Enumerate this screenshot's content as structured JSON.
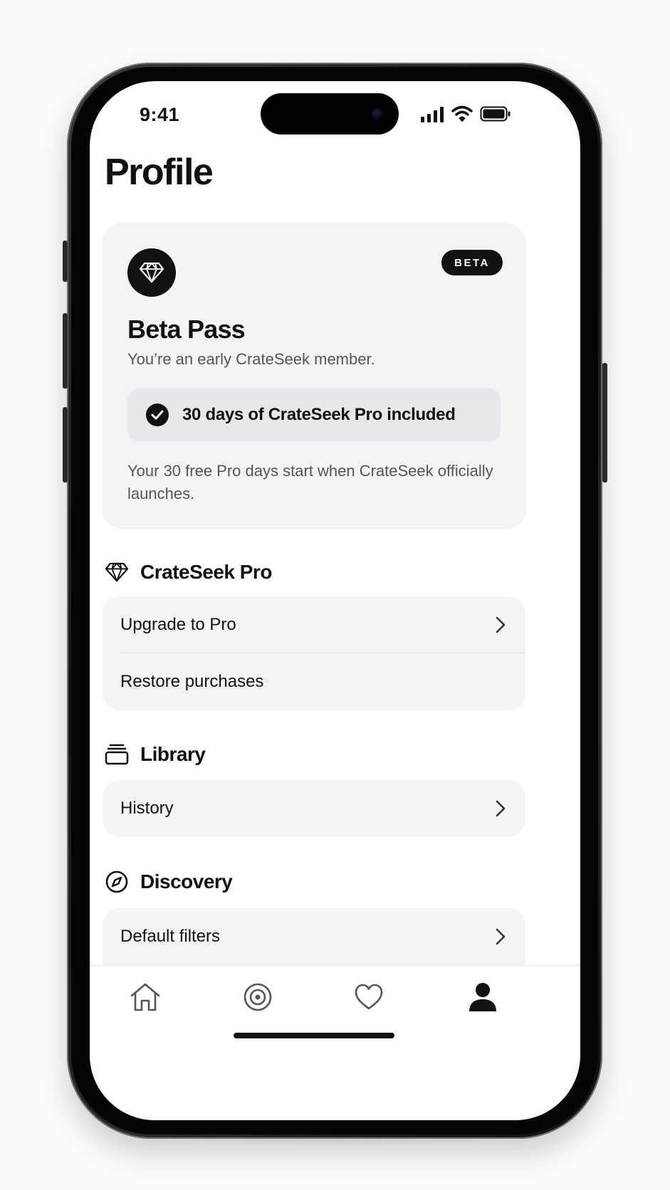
{
  "status_bar": {
    "time": "9:41"
  },
  "page": {
    "title": "Profile"
  },
  "beta_card": {
    "badge": "BETA",
    "title": "Beta Pass",
    "subtitle": "You’re an early CrateSeek member.",
    "included": "30 days of CrateSeek Pro included",
    "note": "Your 30 free Pro days start when CrateSeek officially launches."
  },
  "sections": {
    "pro": {
      "title": "CrateSeek Pro",
      "rows": [
        {
          "label": "Upgrade to Pro"
        },
        {
          "label": "Restore purchases"
        }
      ]
    },
    "library": {
      "title": "Library",
      "rows": [
        {
          "label": "History"
        }
      ]
    },
    "discovery": {
      "title": "Discovery",
      "rows": [
        {
          "label": "Default filters"
        }
      ]
    }
  },
  "tab_bar": {
    "items": [
      {
        "icon": "home-icon",
        "active": false
      },
      {
        "icon": "target-icon",
        "active": false
      },
      {
        "icon": "heart-icon",
        "active": false
      },
      {
        "icon": "person-icon",
        "active": true
      }
    ]
  },
  "colors": {
    "accent": "#111111",
    "card_bg": "#f4f4f6",
    "pill_bg": "#e8e8ec"
  }
}
